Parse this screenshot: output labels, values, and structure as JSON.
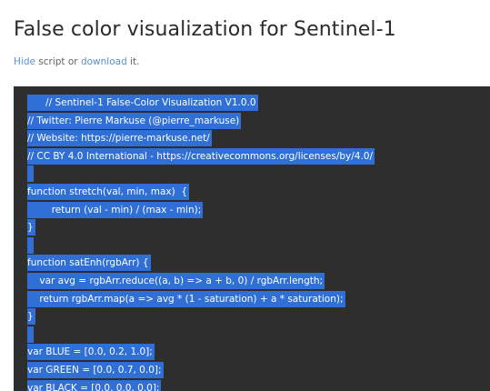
{
  "page": {
    "title": "False color visualization for Sentinel-1",
    "script_links": {
      "hide_label": "Hide",
      "middle_text": " script or ",
      "download_label": "download",
      "tail_text": " it."
    }
  },
  "code": {
    "selection_color": "#2f6fd6",
    "background_color": "#2e2e2e",
    "lines": [
      "      // Sentinel-1 False-Color Visualization V1.0.0",
      "// Twitter: Pierre Markuse (@pierre_markuse)",
      "// Website: https://pierre-markuse.net/",
      "// CC BY 4.0 International - https://creativecommons.org/licenses/by/4.0/",
      "",
      "function stretch(val, min, max)  {",
      "        return (val - min) / (max - min);",
      "}",
      "",
      "function satEnh(rgbArr) {",
      "    var avg = rgbArr.reduce((a, b) => a + b, 0) / rgbArr.length;",
      "    return rgbArr.map(a => avg * (1 - saturation) + a * saturation);",
      "}",
      "",
      "var BLUE = [0.0, 0.2, 1.0];",
      "var GREEN = [0.0, 0.7, 0.0];",
      "var BLACK = [0.0, 0.0, 0.0];"
    ]
  }
}
